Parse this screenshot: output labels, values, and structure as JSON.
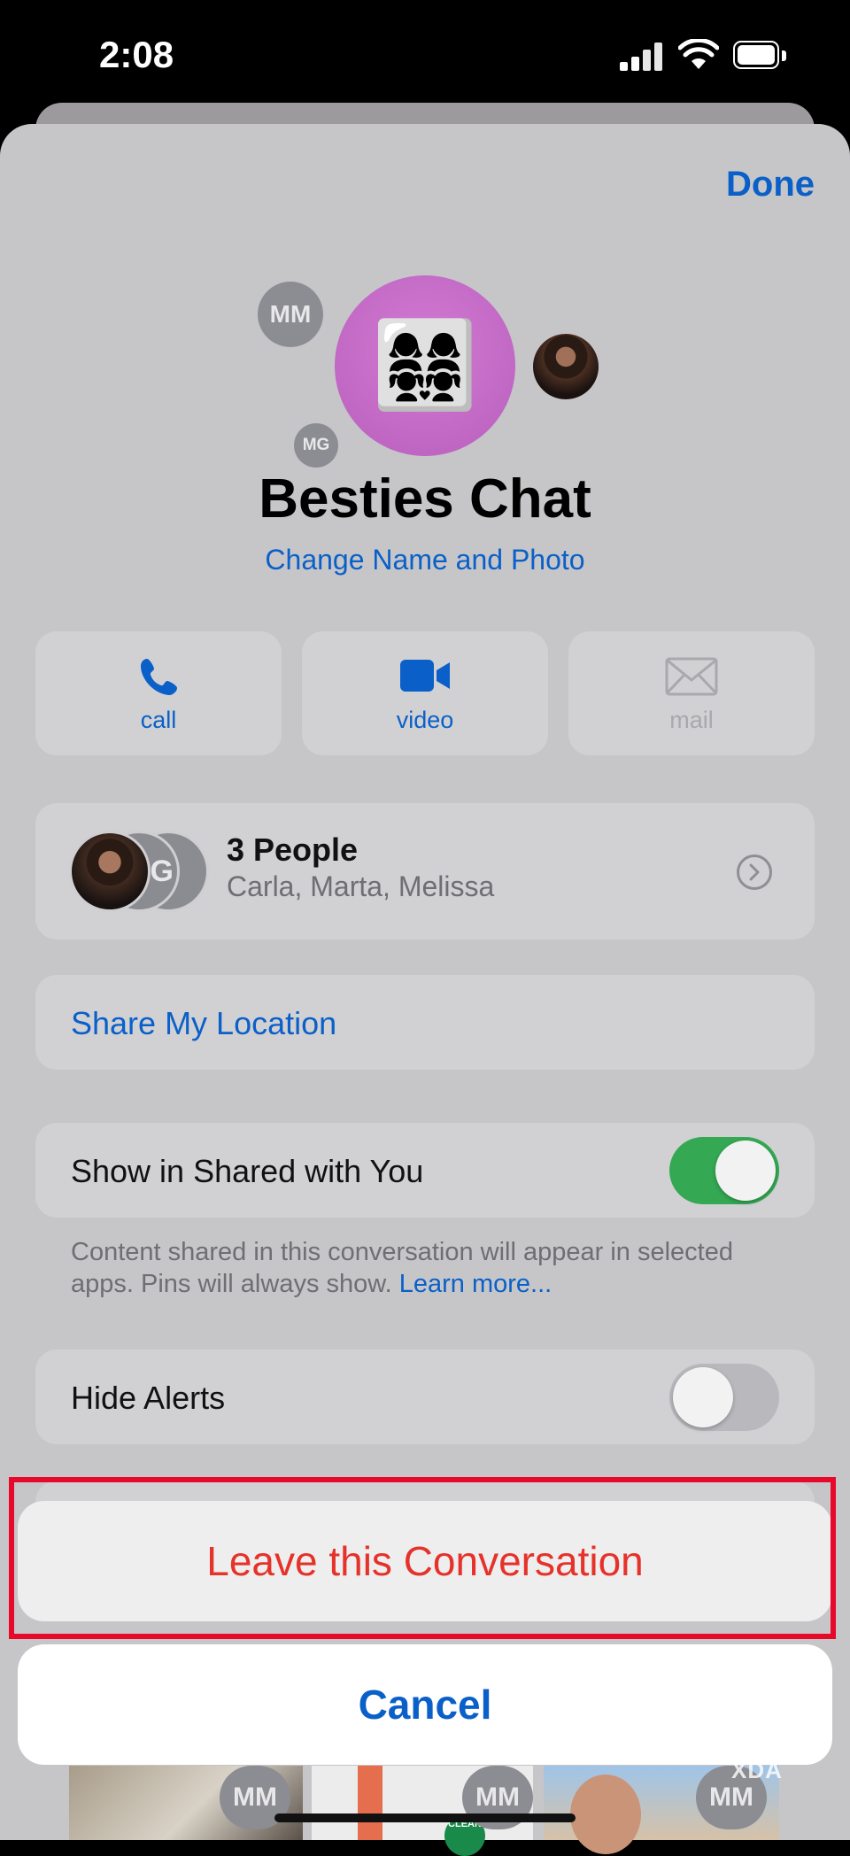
{
  "status_bar": {
    "time": "2:08"
  },
  "header": {
    "done_label": "Done"
  },
  "group": {
    "name": "Besties Chat",
    "change_link": "Change Name and Photo",
    "avatar_emoji": "👩‍👩‍👧‍👧",
    "member_initials": [
      "MM",
      "MG"
    ]
  },
  "actions": [
    {
      "label": "call",
      "icon": "phone-icon",
      "enabled": true
    },
    {
      "label": "video",
      "icon": "video-icon",
      "enabled": true
    },
    {
      "label": "mail",
      "icon": "mail-icon",
      "enabled": false
    }
  ],
  "people": {
    "count_label": "3 People",
    "names": "Carla, Marta, Melissa",
    "stack_initials": "MG"
  },
  "location": {
    "label": "Share My Location"
  },
  "shared": {
    "label": "Show in Shared with You",
    "enabled": true,
    "footnote": "Content shared in this conversation will appear in selected apps. Pins will always show.",
    "learn_more": "Learn more..."
  },
  "hide_alerts": {
    "label": "Hide Alerts",
    "enabled": false
  },
  "sheet": {
    "leave_label": "Leave this Conversation",
    "cancel_label": "Cancel"
  },
  "attachments": {
    "initials": [
      "MM",
      "MM",
      "MM"
    ],
    "badge": "CLEAN"
  },
  "watermark": "XDA",
  "colors": {
    "accent": "#0a60c8",
    "destructive": "#e5322a",
    "toggle_on": "#34a853",
    "highlight": "#e8082a"
  }
}
